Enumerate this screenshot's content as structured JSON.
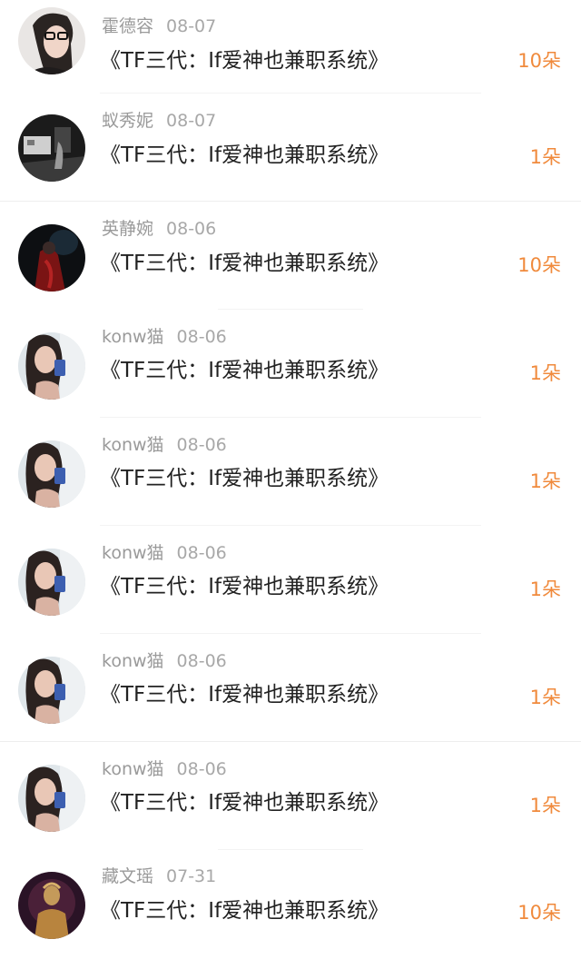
{
  "rows": [
    {
      "user": "霍德容",
      "date": "08-07",
      "title": "《TF三代：If爱神也兼职系统》",
      "gift": "10朵"
    },
    {
      "user": "蚁秀妮",
      "date": "08-07",
      "title": "《TF三代：If爱神也兼职系统》",
      "gift": "1朵"
    },
    {
      "user": "英静婉",
      "date": "08-06",
      "title": "《TF三代：If爱神也兼职系统》",
      "gift": "10朵"
    },
    {
      "user": "konw猫",
      "date": "08-06",
      "title": "《TF三代：If爱神也兼职系统》",
      "gift": "1朵"
    },
    {
      "user": "konw猫",
      "date": "08-06",
      "title": "《TF三代：If爱神也兼职系统》",
      "gift": "1朵"
    },
    {
      "user": "konw猫",
      "date": "08-06",
      "title": "《TF三代：If爱神也兼职系统》",
      "gift": "1朵"
    },
    {
      "user": "konw猫",
      "date": "08-06",
      "title": "《TF三代：If爱神也兼职系统》",
      "gift": "1朵"
    },
    {
      "user": "konw猫",
      "date": "08-06",
      "title": "《TF三代：If爱神也兼职系统》",
      "gift": "1朵"
    },
    {
      "user": "藏文瑶",
      "date": "07-31",
      "title": "《TF三代：If爱神也兼职系统》",
      "gift": "10朵"
    }
  ],
  "colors": {
    "gift": "#f08a3c",
    "title": "#222222",
    "meta": "#9a9a9a"
  }
}
